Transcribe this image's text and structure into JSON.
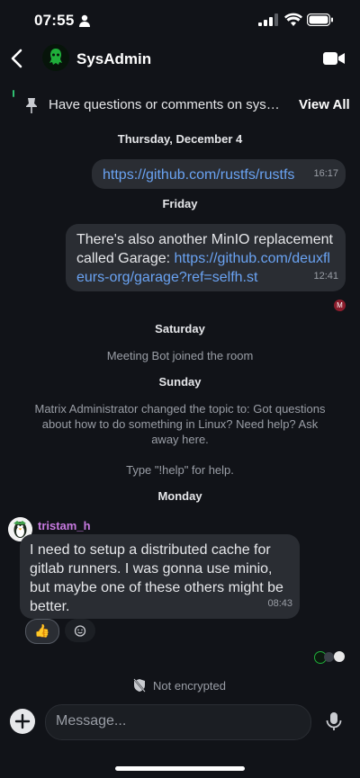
{
  "status_bar": {
    "time": "07:55"
  },
  "header": {
    "room_name": "SysAdmin"
  },
  "pinned": {
    "text": "Have questions or comments on syste…",
    "view_all": "View All"
  },
  "timeline": {
    "day1": "Thursday, December 4",
    "msg1": {
      "link": "https://github.com/rustfs/rustfs",
      "time": "16:17"
    },
    "day2": "Friday",
    "msg2": {
      "text": "There's also another MinIO replacement called Garage: ",
      "link": "https://github.com/deuxfleurs-org/garage?ref=selfh.st",
      "time": "12:41"
    },
    "read_marker": "M",
    "day3": "Saturday",
    "event1": "Meeting Bot joined the room",
    "day4": "Sunday",
    "event2_line1": "Matrix Administrator changed the topic to: Got questions about how to do something in Linux? Need help? Ask away here.",
    "event2_line2": "Type \"!help\" for help.",
    "day5": "Monday",
    "msg3": {
      "sender": "tristam_h",
      "text": "I need to setup a distributed cache for gitlab runners.  I was gonna use minio, but maybe one of these others might be better.",
      "time": "08:43",
      "reaction": "👍"
    }
  },
  "encryption_notice": "Not encrypted",
  "composer": {
    "placeholder": "Message..."
  },
  "colors": {
    "background": "#111318",
    "bubble": "#2a2d33",
    "link": "#6aa3f3",
    "sender": "#c77ae0"
  }
}
